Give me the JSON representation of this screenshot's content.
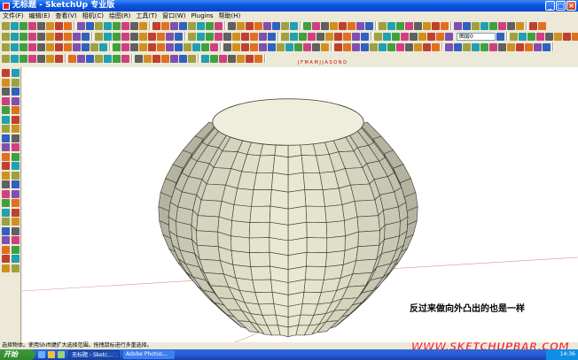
{
  "window": {
    "title": "无标题 - SketchUp 专业版",
    "buttons": [
      "_",
      "□",
      "×"
    ]
  },
  "menubar": {
    "items": [
      "文件(F)",
      "编辑(E)",
      "查看(V)",
      "相机(C)",
      "绘图(R)",
      "工具(T)",
      "窗口(W)",
      "Plugins",
      "帮助(H)"
    ]
  },
  "toolbar": {
    "layer_select": "图层0",
    "shadow_months": "J F M A M J J A S O N D",
    "shadow_time_start": "06:43 AM",
    "shadow_time_mid": "中午",
    "shadow_time_end": "04:46 PM"
  },
  "viewport": {
    "caption": "反过来做向外凸出的也是一样",
    "background": "#ffffff"
  },
  "statusbar": {
    "text": "选择物体。使用Shift键扩大选择范围。拖拽鼠标进行多重选择。"
  },
  "taskbar": {
    "start_label": "开始",
    "tasks": [
      "无标题 - Sketc...",
      "Adobe Photos..."
    ],
    "clock": "14:36"
  },
  "watermark": {
    "text": "WWW.SKETCHUPBAR.COM"
  },
  "colors": {
    "title_bar": "#0a55e0",
    "dome_face": "#efeedd",
    "dome_edge": "#3a3a30",
    "watermark": "#e33333"
  }
}
